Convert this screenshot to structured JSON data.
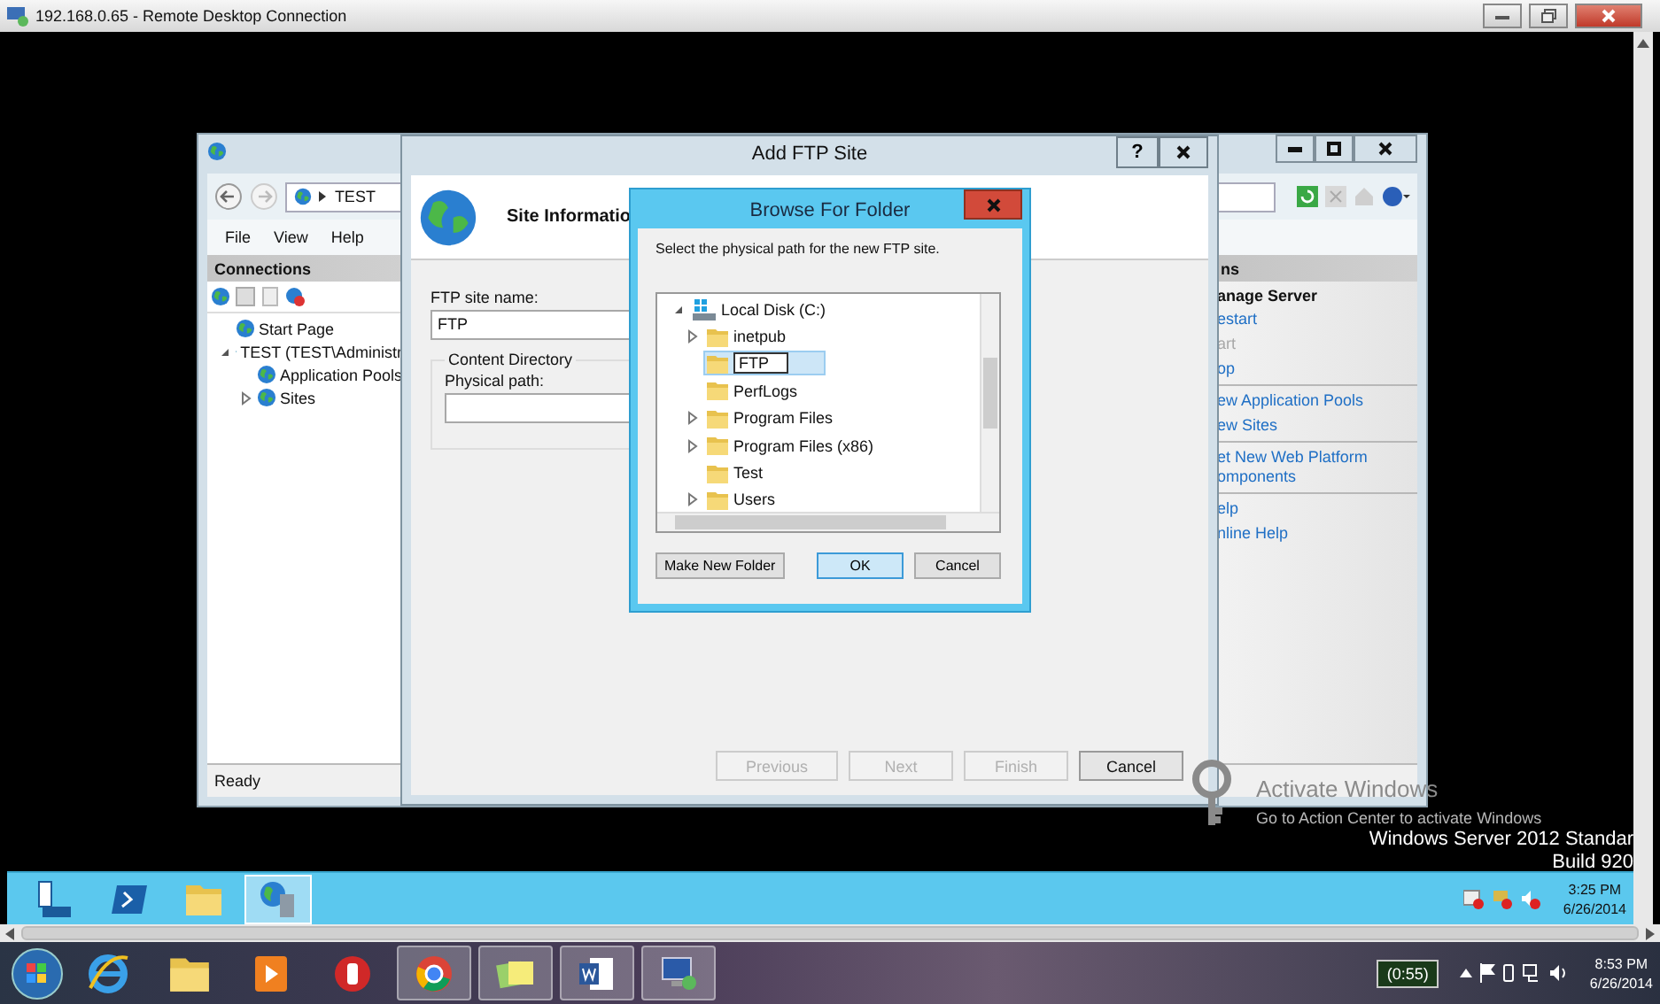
{
  "remote_desktop": {
    "title": "192.168.0.65 - Remote Desktop Connection"
  },
  "iis_manager": {
    "address": "TEST",
    "menu": [
      "File",
      "View",
      "Help"
    ],
    "connections": {
      "title": "Connections",
      "tree": [
        {
          "label": "Start Page"
        },
        {
          "label": "TEST (TEST\\Administr",
          "expanded": true,
          "children": [
            {
              "label": "Application Pools"
            },
            {
              "label": "Sites",
              "expanded": false
            }
          ]
        }
      ]
    },
    "actions": {
      "title": "ns",
      "sections": [
        {
          "heading": "anage Server",
          "items": [
            {
              "label": "estart",
              "disabled": false
            },
            {
              "label": "art",
              "disabled": true
            },
            {
              "label": "op",
              "disabled": false
            }
          ]
        },
        {
          "items": [
            {
              "label": "ew Application Pools",
              "disabled": false
            },
            {
              "label": "ew Sites",
              "disabled": false
            }
          ]
        },
        {
          "items": [
            {
              "label": "et New Web Platform\nomponents",
              "disabled": false
            }
          ]
        },
        {
          "items": [
            {
              "label": "elp",
              "disabled": false
            },
            {
              "label": "nline Help",
              "disabled": false
            }
          ]
        }
      ]
    },
    "status": "Ready"
  },
  "add_ftp_site": {
    "title": "Add FTP Site",
    "help": "?",
    "header": "Site Informatio",
    "site_name_label": "FTP site name:",
    "site_name": "FTP",
    "group_title": "Content Directory",
    "path_label": "Physical path:",
    "buttons": [
      {
        "label": "Previous",
        "disabled": true
      },
      {
        "label": "Next",
        "disabled": true
      },
      {
        "label": "Finish",
        "disabled": true
      },
      {
        "label": "Cancel",
        "disabled": false
      }
    ]
  },
  "browse_for_folder": {
    "title": "Browse For Folder",
    "instruction": "Select the physical path for the new FTP site.",
    "tree": [
      {
        "label": "Local Disk (C:)",
        "kind": "drive",
        "expanded": true,
        "selected": false,
        "children": [
          {
            "label": "inetpub",
            "kind": "folder",
            "expanded": false,
            "selected": false
          },
          {
            "label": "FTP",
            "kind": "folder",
            "selected": true
          },
          {
            "label": "PerfLogs",
            "kind": "folder",
            "selected": false
          },
          {
            "label": "Program Files",
            "kind": "folder",
            "expanded": false,
            "selected": false
          },
          {
            "label": "Program Files (x86)",
            "kind": "folder",
            "expanded": false,
            "selected": false
          },
          {
            "label": "Test",
            "kind": "folder",
            "selected": false
          },
          {
            "label": "Users",
            "kind": "folder",
            "expanded": false,
            "selected": false
          }
        ]
      }
    ],
    "buttons": [
      {
        "label": "Make New Folder",
        "default": false
      },
      {
        "label": "OK",
        "default": true
      },
      {
        "label": "Cancel",
        "default": false
      }
    ]
  },
  "desktop": {
    "activation_title": "Activate Windows",
    "activation_hint": "Go to Action Center to activate Windows",
    "edition": "Windows Server 2012 Standar",
    "build": "Build 920"
  },
  "server_taskbar": {
    "apps": [
      {
        "kind": "server",
        "selected": false
      },
      {
        "kind": "terminal",
        "selected": false
      },
      {
        "kind": "folder",
        "selected": false
      },
      {
        "kind": "globe-server",
        "selected": true
      }
    ],
    "time": "3:25 PM",
    "date": "6/26/2014"
  },
  "local_taskbar": {
    "apps": [
      {
        "kind": "e-globe",
        "running": false
      },
      {
        "kind": "folder",
        "running": false
      },
      {
        "kind": "play",
        "running": false
      },
      {
        "kind": "hand",
        "running": false
      },
      {
        "kind": "round-browser",
        "running": true
      },
      {
        "kind": "notes",
        "running": true
      },
      {
        "kind": "document",
        "running": true
      },
      {
        "kind": "monitor",
        "running": true
      }
    ],
    "battery": "(0:55)",
    "time": "8:53 PM",
    "date": "6/26/2014"
  }
}
